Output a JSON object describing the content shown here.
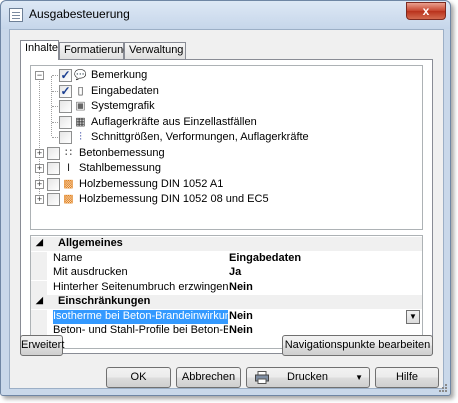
{
  "window": {
    "title": "Ausgabesteuerung",
    "close_glyph": "x"
  },
  "tabs": [
    "Inhalte",
    "Formatierung",
    "Verwaltung"
  ],
  "tree": [
    {
      "label": "Bemerkung",
      "checked": true,
      "icon": "comment-icon"
    },
    {
      "label": "Eingabedaten",
      "checked": true,
      "icon": "document-icon"
    },
    {
      "label": "Systemgrafik",
      "checked": false,
      "icon": "graphic-icon"
    },
    {
      "label": "Auflagerkräfte aus Einzellastfällen",
      "checked": false,
      "icon": "table-icon"
    },
    {
      "label": "Schnittgrößen, Verformungen, Auflagerkräfte",
      "checked": false,
      "icon": "beam-icon"
    },
    {
      "label": "Betonbemessung",
      "checked": false,
      "icon": "concrete-icon"
    },
    {
      "label": "Stahlbemessung",
      "checked": false,
      "icon": "steel-icon"
    },
    {
      "label": "Holzbemessung DIN 1052 A1",
      "checked": false,
      "icon": "timber-icon"
    },
    {
      "label": "Holzbemessung DIN 1052 08 und EC5",
      "checked": false,
      "icon": "timber-icon"
    }
  ],
  "properties": {
    "sections": [
      {
        "title": "Allgemeines",
        "rows": [
          {
            "name": "Name",
            "value": "Eingabedaten"
          },
          {
            "name": "Mit ausdrucken",
            "value": "Ja"
          },
          {
            "name": "Hinterher Seitenumbruch erzwingen",
            "value": "Nein"
          }
        ]
      },
      {
        "title": "Einschränkungen",
        "rows": [
          {
            "name": "Isotherme bei Beton-Brandeinwirkungen n",
            "value": "Nein"
          },
          {
            "name": "Beton- und Stahl-Profile bei Beton-Brande",
            "value": "Nein"
          }
        ]
      }
    ]
  },
  "buttons": {
    "erweitert": "Erweitert",
    "navigation": "Navigationspunkte bearbeiten",
    "ok": "OK",
    "abbrechen": "Abbrechen",
    "drucken": "Drucken",
    "hilfe": "Hilfe"
  },
  "colors": {
    "selection": "#3399ff",
    "checkmark": "#1b3f91"
  }
}
